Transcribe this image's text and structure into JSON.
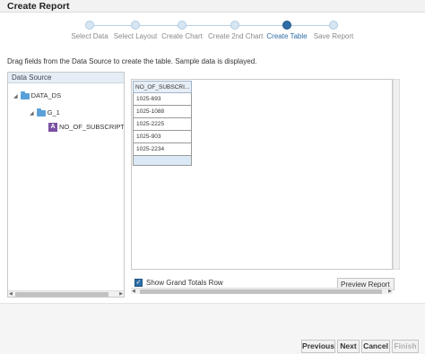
{
  "window": {
    "title": "Create Report"
  },
  "train": {
    "steps": [
      {
        "label": "Select Data"
      },
      {
        "label": "Select Layout"
      },
      {
        "label": "Create Chart"
      },
      {
        "label": "Create 2nd Chart"
      },
      {
        "label": "Create Table"
      },
      {
        "label": "Save Report"
      }
    ],
    "current_index": 4
  },
  "instruction": "Drag fields from the Data Source to create the table. Sample data is displayed.",
  "data_source": {
    "header": "Data Source",
    "tree": {
      "root": "DATA_DS",
      "group": "G_1",
      "field": "NO_OF_SUBSCRIPTIO",
      "field_icon_letter": "A"
    }
  },
  "table": {
    "column_header": "NO_OF_SUBSCRI...",
    "rows": [
      "1025-693",
      "1025-1088",
      "1025-2225",
      "1025-903",
      "1025-2234"
    ],
    "show_grand_totals": {
      "label": "Show Grand Totals Row",
      "checked": true
    }
  },
  "buttons": {
    "preview": "Preview Report",
    "previous": "Previous",
    "next": "Next",
    "cancel": "Cancel",
    "finish": "Finish"
  },
  "colors": {
    "accent": "#2e6ea6",
    "step_inactive": "#d8e6f2",
    "folder": "#5aa0d8",
    "attribute_icon": "#7a4fa3"
  }
}
